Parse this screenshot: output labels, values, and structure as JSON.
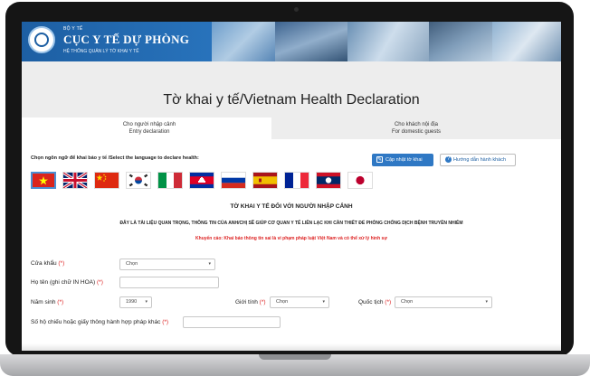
{
  "header": {
    "ministry": "BỘ Y TẾ",
    "agency": "CỤC Y TẾ DỰ PHÒNG",
    "system": "HỆ THỐNG QUẢN LÝ TỜ KHAI Y TẾ"
  },
  "page_title": "Tờ khai y tế/Vietnam Health Declaration",
  "tabs": [
    {
      "label": "Cho người nhập cảnh",
      "sublabel": "Entry declaration",
      "active": true
    },
    {
      "label": "Cho khách nội địa",
      "sublabel": "For domestic guests",
      "active": false
    }
  ],
  "language_prompt": "Chọn ngôn ngữ để khai báo y tế /Select the language to declare health:",
  "buttons": {
    "update": "Cập nhật tờ khai",
    "guide": "Hướng dẫn hành khách"
  },
  "flags": [
    {
      "icon": "vietnam-flag-icon",
      "selected": true
    },
    {
      "icon": "uk-flag-icon"
    },
    {
      "icon": "china-flag-icon"
    },
    {
      "icon": "korea-flag-icon"
    },
    {
      "icon": "italy-flag-icon"
    },
    {
      "icon": "cambodia-flag-icon"
    },
    {
      "icon": "russia-flag-icon"
    },
    {
      "icon": "spain-flag-icon"
    },
    {
      "icon": "france-flag-icon"
    },
    {
      "icon": "laos-flag-icon"
    },
    {
      "icon": "japan-flag-icon"
    }
  ],
  "form": {
    "title": "TỜ KHAI Y TẾ ĐỐI VỚI NGƯỜI NHẬP CẢNH",
    "note": "ĐÂY LÀ TÀI LIỆU QUAN TRỌNG, THÔNG TIN CỦA ANH/CHỊ SẼ GIÚP CƠ QUAN Y TẾ LIÊN LẠC KHI CẦN THIẾT ĐỂ PHÒNG CHỐNG DỊCH BỆNH TRUYỀN NHIỄM",
    "warning": "Khuyến cáo: Khai báo thông tin sai là vi phạm pháp luật Việt Nam và có thể xử lý hình sự",
    "required_mark": "(*)",
    "border_gate": {
      "label": "Cửa khẩu",
      "value": "Chọn"
    },
    "full_name": {
      "label": "Họ tên (ghi chữ IN HOA)",
      "value": ""
    },
    "birth_year": {
      "label": "Năm sinh",
      "value": "1990"
    },
    "gender": {
      "label": "Giới tính",
      "value": "Chọn"
    },
    "nationality": {
      "label": "Quốc tịch",
      "value": "Chọn"
    },
    "passport": {
      "label": "Số hộ chiếu hoặc giấy thông hành hợp pháp khác",
      "value": ""
    }
  },
  "colors": {
    "header_blue": "#1d5fa3",
    "button_blue": "#2f78c4",
    "warning_red": "#d22222"
  }
}
